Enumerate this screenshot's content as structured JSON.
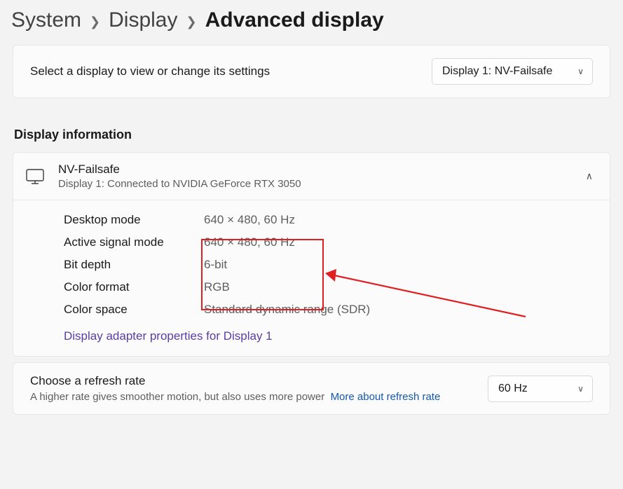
{
  "breadcrumb": {
    "system": "System",
    "display": "Display",
    "advanced": "Advanced display"
  },
  "selectRow": {
    "label": "Select a display to view or change its settings",
    "dropdown": "Display 1: NV-Failsafe"
  },
  "displayInfo": {
    "sectionTitle": "Display information",
    "name": "NV-Failsafe",
    "subtitle": "Display 1: Connected to NVIDIA GeForce RTX 3050",
    "rows": {
      "desktopMode": {
        "key": "Desktop mode",
        "val": "640 × 480, 60 Hz"
      },
      "activeSignalMode": {
        "key": "Active signal mode",
        "val": "640 × 480, 60 Hz"
      },
      "bitDepth": {
        "key": "Bit depth",
        "val": "6-bit"
      },
      "colorFormat": {
        "key": "Color format",
        "val": "RGB"
      },
      "colorSpace": {
        "key": "Color space",
        "val": "Standard dynamic range (SDR)"
      }
    },
    "adapterLink": "Display adapter properties for Display 1"
  },
  "refresh": {
    "title": "Choose a refresh rate",
    "sub": "A higher rate gives smoother motion, but also uses more power",
    "moreLink": "More about refresh rate",
    "dropdown": "60 Hz"
  }
}
